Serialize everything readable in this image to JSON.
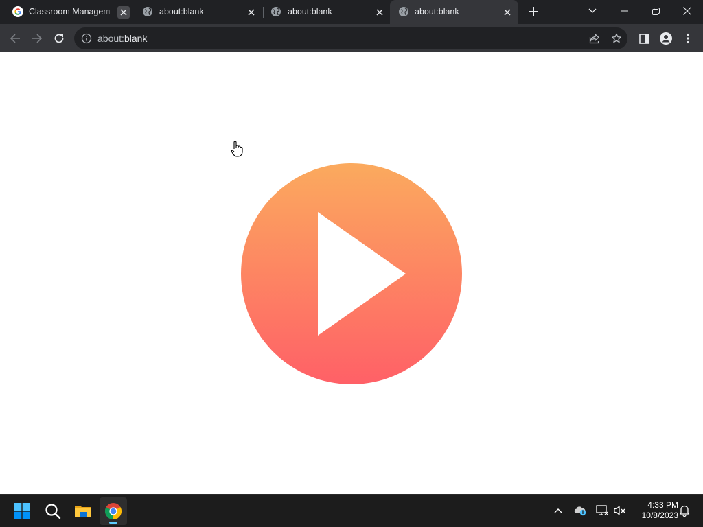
{
  "browser": {
    "tabs": [
      {
        "title": "Classroom Manageme",
        "favicon": "google-g-icon",
        "active": false
      },
      {
        "title": "about:blank",
        "favicon": "globe-icon",
        "active": false
      },
      {
        "title": "about:blank",
        "favicon": "globe-icon",
        "active": false
      },
      {
        "title": "about:blank",
        "favicon": "globe-icon",
        "active": true
      }
    ],
    "omnibox": {
      "scheme": "about:",
      "host": "blank"
    }
  },
  "page": {
    "content": "play-button-icon",
    "colors": {
      "gradient_top": "#fbaa5e",
      "gradient_bottom": "#ff6067"
    }
  },
  "taskbar": {
    "apps": [
      "windows-start-icon",
      "search-icon",
      "file-explorer-icon",
      "chrome-icon"
    ],
    "clock": {
      "time": "4:33 PM",
      "date": "10/8/2023"
    }
  }
}
